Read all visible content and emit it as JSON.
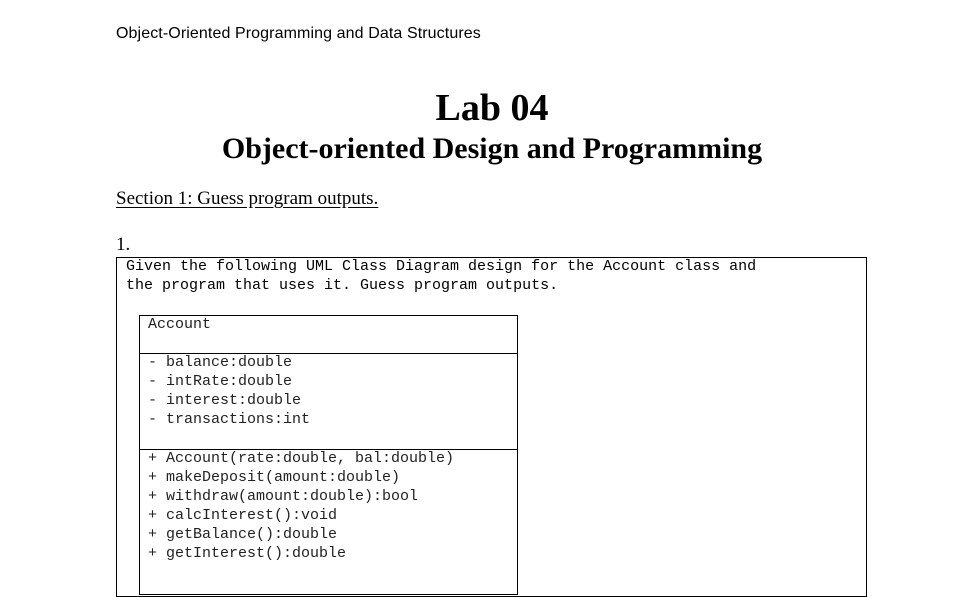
{
  "document": {
    "course_header": "Object-Oriented Programming and Data Structures",
    "lab_title": "Lab 04",
    "lab_subtitle": "Object-oriented Design and Programming",
    "section_heading": "Section 1: Guess program outputs.",
    "item_number": "1.",
    "prompt_lines": [
      "Given the following UML Class Diagram design for the Account class and",
      "the program that uses it. Guess program outputs."
    ]
  },
  "uml_class": {
    "name": "Account",
    "attributes": [
      "- balance:double",
      "- intRate:double",
      "- interest:double",
      "- transactions:int"
    ],
    "methods": [
      "+ Account(rate:double, bal:double)",
      "+ makeDeposit(amount:double)",
      "+ withdraw(amount:double):bool",
      "+ calcInterest():void",
      "+ getBalance():double",
      "+ getInterest():double"
    ]
  }
}
